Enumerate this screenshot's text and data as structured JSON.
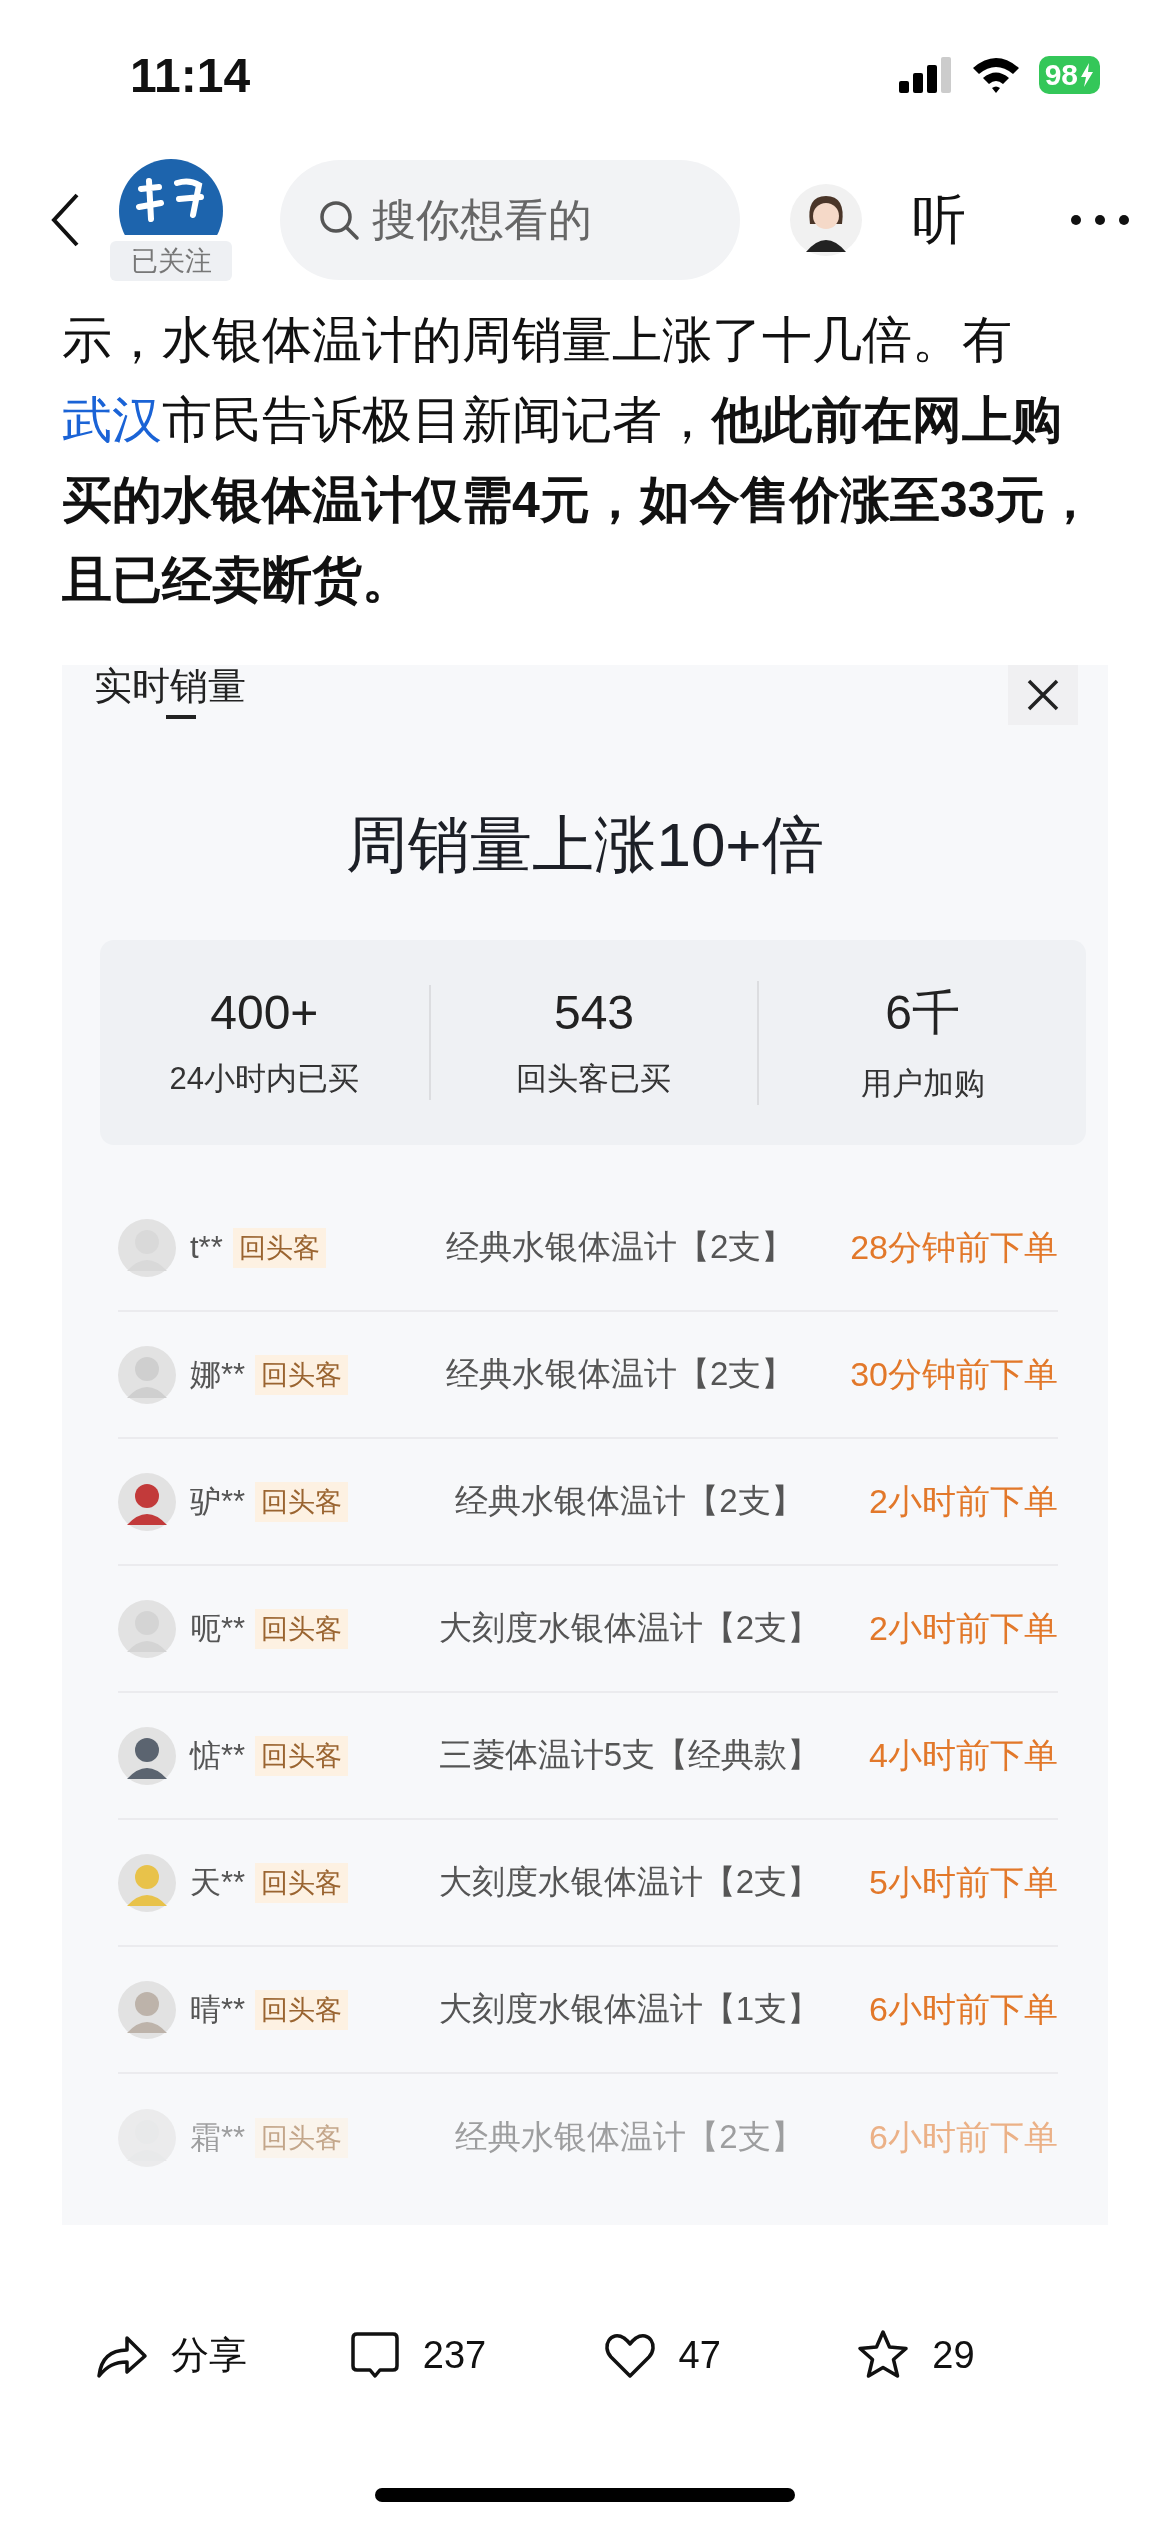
{
  "status_bar": {
    "time": "11:14",
    "battery": "98"
  },
  "nav": {
    "followed_badge": "已关注",
    "search": {
      "placeholder": "搜你想看的"
    },
    "listen_label": "听"
  },
  "article": {
    "paragraph": [
      {
        "kind": "plain",
        "text": "示，水银体温计的周销量上涨了十几倍。有"
      },
      {
        "kind": "link",
        "text": "武汉"
      },
      {
        "kind": "plain",
        "text": "市民告诉极目新闻记者，"
      },
      {
        "kind": "bold",
        "text": "他此前在网上购买的水银体温计仅需4元，如今售价涨至33元，且已经卖断货。"
      }
    ]
  },
  "embedded_screenshot": {
    "tab": {
      "label": "实时销量",
      "selected": true
    },
    "title": "周销量上涨10+倍",
    "stats": [
      {
        "value": "400+",
        "label": "24小时内已买"
      },
      {
        "value": "543",
        "label": "回头客已买"
      },
      {
        "value": "6千",
        "label": "用户加购"
      }
    ],
    "orders": [
      {
        "name": "t**",
        "tag": "回头客",
        "product": "经典水银体温计【2支】",
        "time": "28分钟前下单",
        "faded": false
      },
      {
        "name": "娜**",
        "tag": "回头客",
        "product": "经典水银体温计【2支】",
        "time": "30分钟前下单",
        "faded": false
      },
      {
        "name": "驴**",
        "tag": "回头客",
        "product": "经典水银体温计【2支】",
        "time": "2小时前下单",
        "faded": false
      },
      {
        "name": "呃**",
        "tag": "回头客",
        "product": "大刻度水银体温计【2支】",
        "time": "2小时前下单",
        "faded": false
      },
      {
        "name": "惦**",
        "tag": "回头客",
        "product": "三菱体温计5支【经典款】",
        "time": "4小时前下单",
        "faded": false
      },
      {
        "name": "天**",
        "tag": "回头客",
        "product": "大刻度水银体温计【2支】",
        "time": "5小时前下单",
        "faded": false
      },
      {
        "name": "晴**",
        "tag": "回头客",
        "product": "大刻度水银体温计【1支】",
        "time": "6小时前下单",
        "faded": false
      },
      {
        "name": "霜**",
        "tag": "回头客",
        "product": "经典水银体温计【2支】",
        "time": "6小时前下单",
        "faded": true
      }
    ]
  },
  "action_bar": [
    {
      "kind": "share",
      "label": "分享"
    },
    {
      "kind": "comment",
      "label": "237"
    },
    {
      "kind": "like",
      "label": "47"
    },
    {
      "kind": "favorite",
      "label": "29"
    }
  ]
}
